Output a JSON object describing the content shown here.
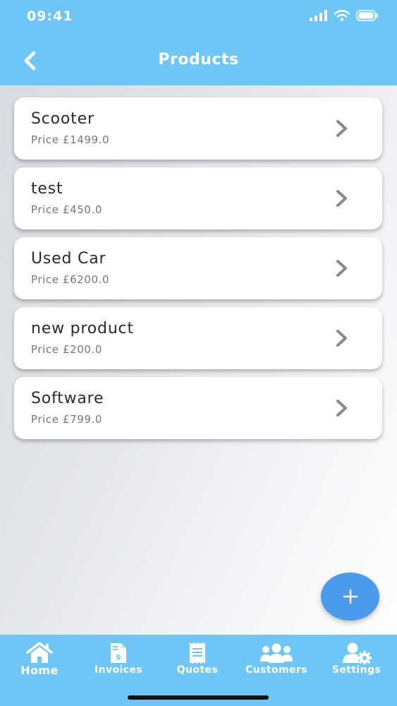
{
  "status_bar": {
    "time": "09:41"
  },
  "header": {
    "title": "Products"
  },
  "products": [
    {
      "name": "Scooter",
      "price": "Price £1499.0"
    },
    {
      "name": "test",
      "price": "Price £450.0"
    },
    {
      "name": "Used Car",
      "price": "Price £6200.0"
    },
    {
      "name": "new product",
      "price": "Price £200.0"
    },
    {
      "name": "Software",
      "price": "Price £799.0"
    }
  ],
  "fab": {
    "icon": "plus-icon"
  },
  "tabbar": {
    "tabs": [
      {
        "label": "Home",
        "icon": "home-icon"
      },
      {
        "label": "Invoices",
        "icon": "invoice-icon"
      },
      {
        "label": "Quotes",
        "icon": "receipt-icon"
      },
      {
        "label": "Customers",
        "icon": "users-icon"
      },
      {
        "label": "Settings",
        "icon": "user-settings-icon"
      }
    ]
  },
  "colors": {
    "header": "#6ec6f6",
    "fab": "#4a9bec",
    "chevron": "#8a8a8a"
  }
}
